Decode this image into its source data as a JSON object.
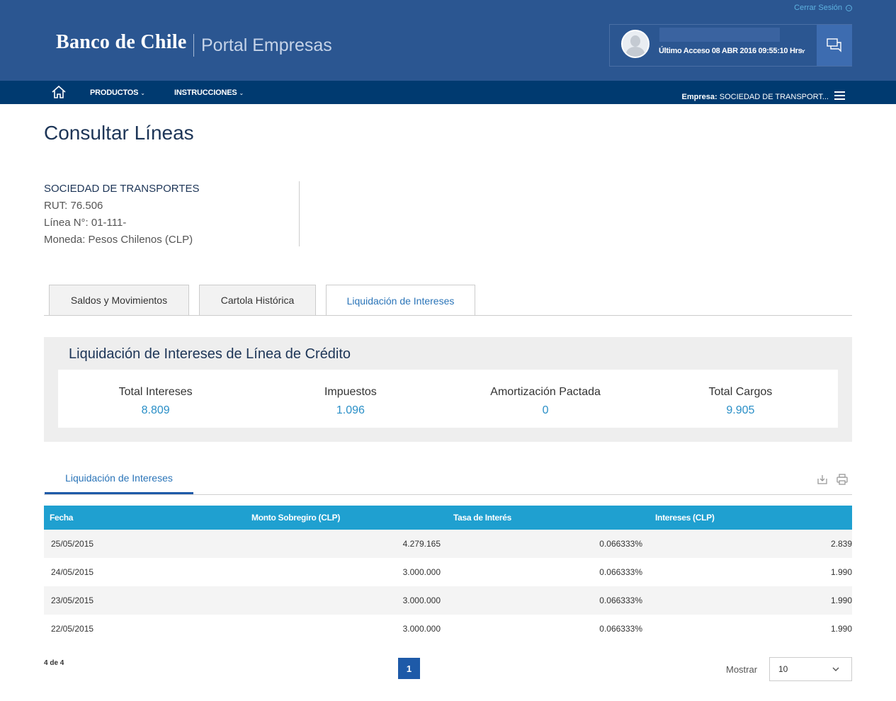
{
  "header": {
    "logout": "Cerrar Sesión",
    "brand": "Banco de Chile",
    "portal": "Portal Empresas",
    "last_access": "Último Acceso 08 ABR 2016 09:55:10 Hrs."
  },
  "nav": {
    "items": [
      "PRODUCTOS",
      "INSTRUCCIONES"
    ],
    "company_label": "Empresa:",
    "company_value": "SOCIEDAD DE TRANSPORT..."
  },
  "page": {
    "title": "Consultar Líneas"
  },
  "account": {
    "company": "SOCIEDAD DE TRANSPORTES",
    "rut": "RUT: 76.506",
    "line": "Línea N°: 01-111-",
    "currency": "Moneda: Pesos Chilenos (CLP)"
  },
  "tabs": [
    "Saldos y Movimientos",
    "Cartola Histórica",
    "Liquidación de Intereses"
  ],
  "summary": {
    "title": "Liquidación de Intereses de Línea de Crédito",
    "cells": [
      {
        "label": "Total Intereses",
        "value": "8.809"
      },
      {
        "label": "Impuestos",
        "value": "1.096"
      },
      {
        "label": "Amortización Pactada",
        "value": "0"
      },
      {
        "label": "Total Cargos",
        "value": "9.905"
      }
    ]
  },
  "subtab": "Liquidación de Intereses",
  "table": {
    "headers": [
      "Fecha",
      "Monto Sobregiro (CLP)",
      "Tasa de Interés",
      "Intereses (CLP)"
    ],
    "rows": [
      [
        "25/05/2015",
        "4.279.165",
        "0.066333%",
        "2.839"
      ],
      [
        "24/05/2015",
        "3.000.000",
        "0.066333%",
        "1.990"
      ],
      [
        "23/05/2015",
        "3.000.000",
        "0.066333%",
        "1.990"
      ],
      [
        "22/05/2015",
        "3.000.000",
        "0.066333%",
        "1.990"
      ]
    ]
  },
  "footer": {
    "count": "4 de 4",
    "page": "1",
    "show_label": "Mostrar",
    "show_value": "10"
  },
  "colors": {
    "header": "#2b5691",
    "nav": "#003a70",
    "table_header": "#1fa0d0",
    "accent_value": "#2a8fc7"
  }
}
